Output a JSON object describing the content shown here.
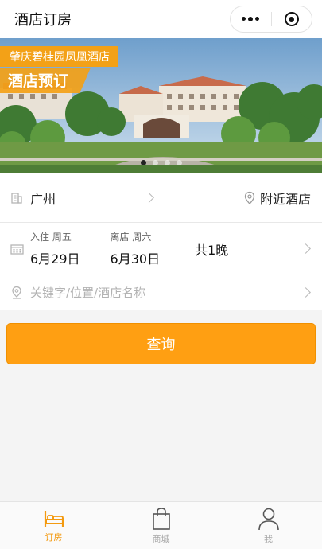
{
  "header": {
    "title": "酒店订房"
  },
  "banner": {
    "ribbon_line1": "肇庆碧桂园凤凰酒店",
    "ribbon_line2": "酒店预订",
    "slide_count": 4,
    "active_slide": 1
  },
  "city_row": {
    "city": "广州",
    "nearby_label": "附近酒店"
  },
  "date_row": {
    "checkin_label": "入住 周五",
    "checkin_date": "6月29日",
    "checkout_label": "离店 周六",
    "checkout_date": "6月30日",
    "nights": "共1晚"
  },
  "keyword_row": {
    "placeholder": "关键字/位置/酒店名称",
    "value": ""
  },
  "search_button": {
    "label": "查询"
  },
  "tabbar": {
    "tabs": [
      {
        "label": "订房",
        "icon": "bed-icon",
        "active": true
      },
      {
        "label": "商城",
        "icon": "shopping-bag-icon",
        "active": false
      },
      {
        "label": "我",
        "icon": "user-icon",
        "active": false
      }
    ]
  },
  "colors": {
    "accent": "#ff9f12",
    "ribbon": "#f3a117",
    "tab_active": "#f39a10",
    "tab_inactive": "#a8a8a8"
  }
}
